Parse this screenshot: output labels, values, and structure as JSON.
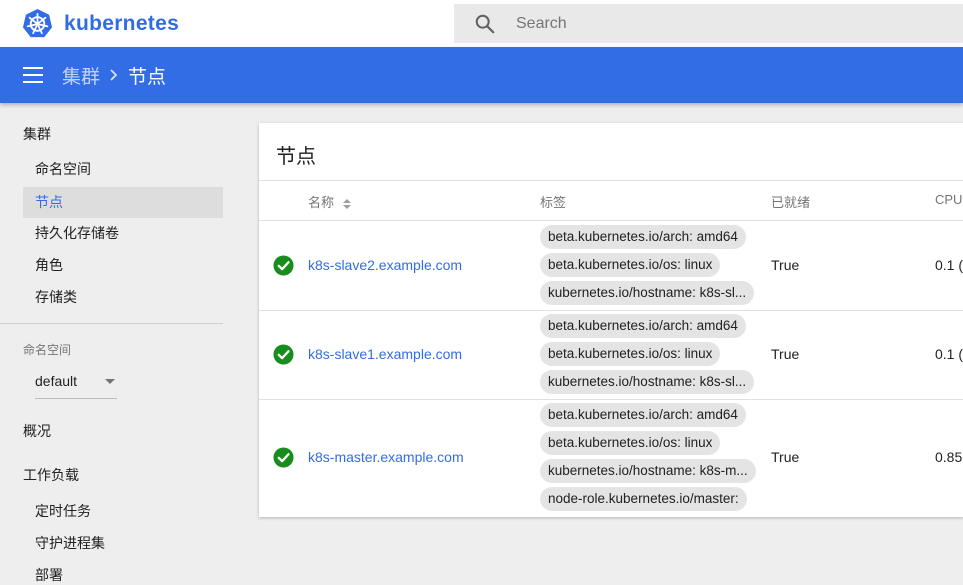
{
  "app": {
    "name": "kubernetes"
  },
  "search": {
    "placeholder": "Search"
  },
  "breadcrumb": {
    "parent": "集群",
    "current": "节点"
  },
  "sidebar": {
    "cluster_heading": "集群",
    "cluster_items": [
      {
        "label": "命名空间",
        "active": false
      },
      {
        "label": "节点",
        "active": true
      },
      {
        "label": "持久化存储卷",
        "active": false
      },
      {
        "label": "角色",
        "active": false
      },
      {
        "label": "存储类",
        "active": false
      }
    ],
    "namespace_label": "命名空间",
    "namespace_value": "default",
    "overview": "概况",
    "workloads_heading": "工作负载",
    "workload_items": [
      "定时任务",
      "守护进程集",
      "部署"
    ]
  },
  "card": {
    "title": "节点",
    "columns": {
      "name": "名称",
      "labels": "标签",
      "ready": "已就绪",
      "cpu": "CPU"
    },
    "rows": [
      {
        "name": "k8s-slave2.example.com",
        "status": "ok",
        "labels": [
          "beta.kubernetes.io/arch: amd64",
          "beta.kubernetes.io/os: linux",
          "kubernetes.io/hostname: k8s-sl..."
        ],
        "ready": "True",
        "cpu": "0.1 ("
      },
      {
        "name": "k8s-slave1.example.com",
        "status": "ok",
        "labels": [
          "beta.kubernetes.io/arch: amd64",
          "beta.kubernetes.io/os: linux",
          "kubernetes.io/hostname: k8s-sl..."
        ],
        "ready": "True",
        "cpu": "0.1 ("
      },
      {
        "name": "k8s-master.example.com",
        "status": "ok",
        "labels": [
          "beta.kubernetes.io/arch: amd64",
          "beta.kubernetes.io/os: linux",
          "kubernetes.io/hostname: k8s-m...",
          "node-role.kubernetes.io/master:"
        ],
        "ready": "True",
        "cpu": "0.85"
      }
    ]
  },
  "colors": {
    "brand": "#326ce5",
    "navbar": "#326de6",
    "status_ok": "#188d1e"
  },
  "icons": {
    "logo": "kubernetes-helm-icon",
    "search": "search-icon",
    "menu": "menu-icon",
    "status": "check-circle-icon",
    "sort": "sort-icon"
  }
}
